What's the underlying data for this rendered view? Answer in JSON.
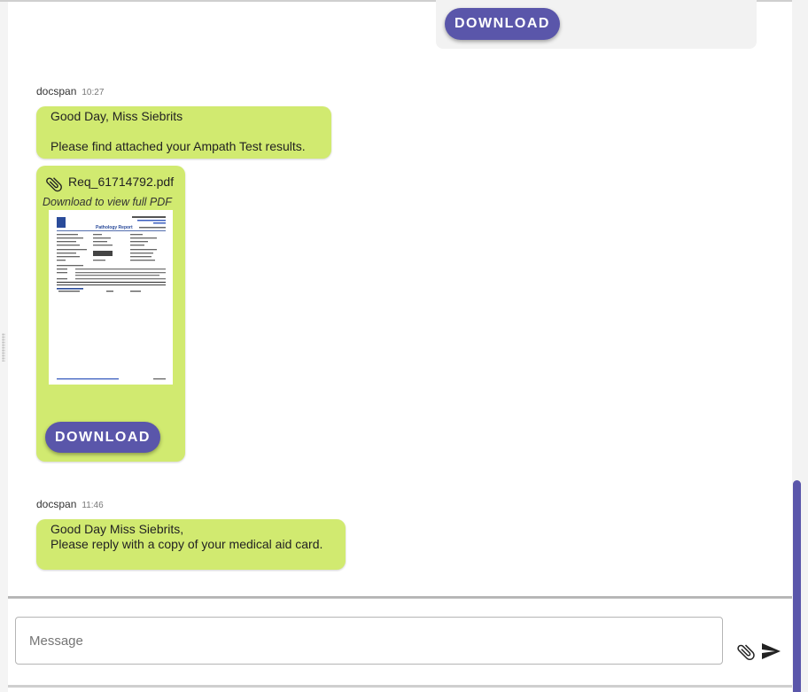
{
  "previous_card": {
    "download_label": "DOWNLOAD"
  },
  "messages": [
    {
      "sender": "docspan",
      "time": "10:27",
      "lines": [
        "Good Day, Miss Siebrits",
        "Please find attached your Ampath Test results."
      ],
      "attachment": {
        "file_name": "Req_61714792.pdf",
        "hint": "Download to view full PDF",
        "download_label": "DOWNLOAD",
        "preview_title": "Pathology Report"
      }
    },
    {
      "sender": "docspan",
      "time": "11:46",
      "lines": [
        "Good Day Miss Siebrits,",
        "Please reply with a copy of your medical aid card."
      ]
    }
  ],
  "composer": {
    "placeholder": "Message"
  },
  "icons": {
    "attach": "paperclip-icon",
    "send": "send-icon"
  },
  "colors": {
    "bubble": "#d1ea70",
    "accent": "#5a56aa",
    "card_gray": "#f2f2f2"
  }
}
